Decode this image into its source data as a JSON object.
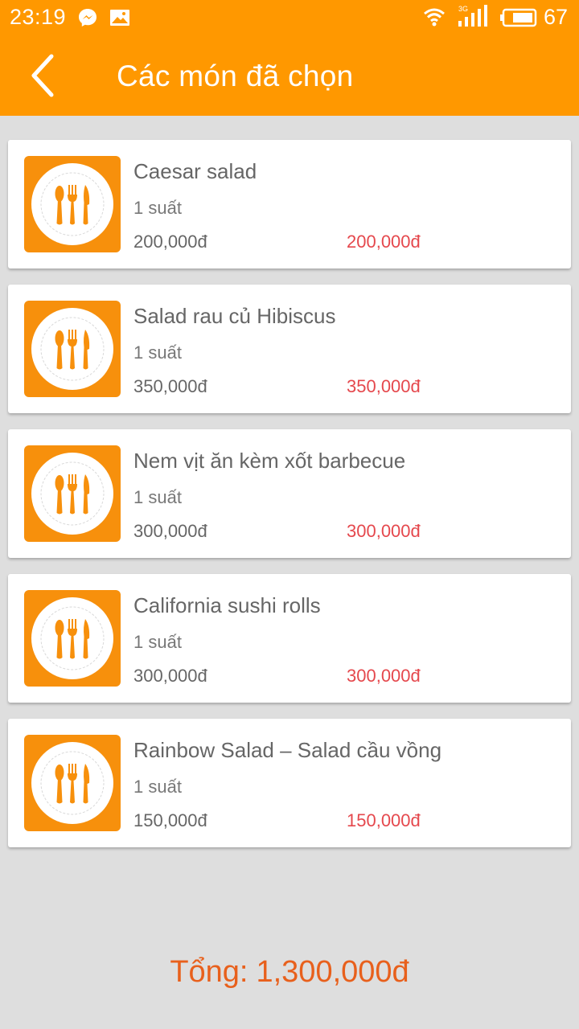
{
  "status_bar": {
    "time": "23:19",
    "network": "3G",
    "battery": "67",
    "icons": [
      "messenger-icon",
      "gallery-icon",
      "wifi-icon",
      "signal-icon",
      "battery-icon"
    ]
  },
  "toolbar": {
    "title": "Các món đã chọn",
    "back_icon": "chevron-left-icon"
  },
  "colors": {
    "accent": "#ff9800",
    "price_total": "#e5484d",
    "grand_total": "#e8601c",
    "background": "#dedede"
  },
  "items": [
    {
      "name": "Caesar salad",
      "quantity": "1 suất",
      "price": "200,000đ",
      "subtotal": "200,000đ",
      "icon": "plate-cutlery-icon"
    },
    {
      "name": "Salad rau củ Hibiscus",
      "quantity": "1 suất",
      "price": "350,000đ",
      "subtotal": "350,000đ",
      "icon": "plate-cutlery-icon"
    },
    {
      "name": "Nem vịt ăn kèm xốt barbecue",
      "quantity": "1 suất",
      "price": "300,000đ",
      "subtotal": "300,000đ",
      "icon": "plate-cutlery-icon"
    },
    {
      "name": "California sushi rolls",
      "quantity": "1 suất",
      "price": "300,000đ",
      "subtotal": "300,000đ",
      "icon": "plate-cutlery-icon"
    },
    {
      "name": "Rainbow Salad – Salad cầu vồng",
      "quantity": "1 suất",
      "price": "150,000đ",
      "subtotal": "150,000đ",
      "icon": "plate-cutlery-icon"
    }
  ],
  "total": {
    "label": "Tổng:",
    "amount": "1,300,000đ"
  }
}
